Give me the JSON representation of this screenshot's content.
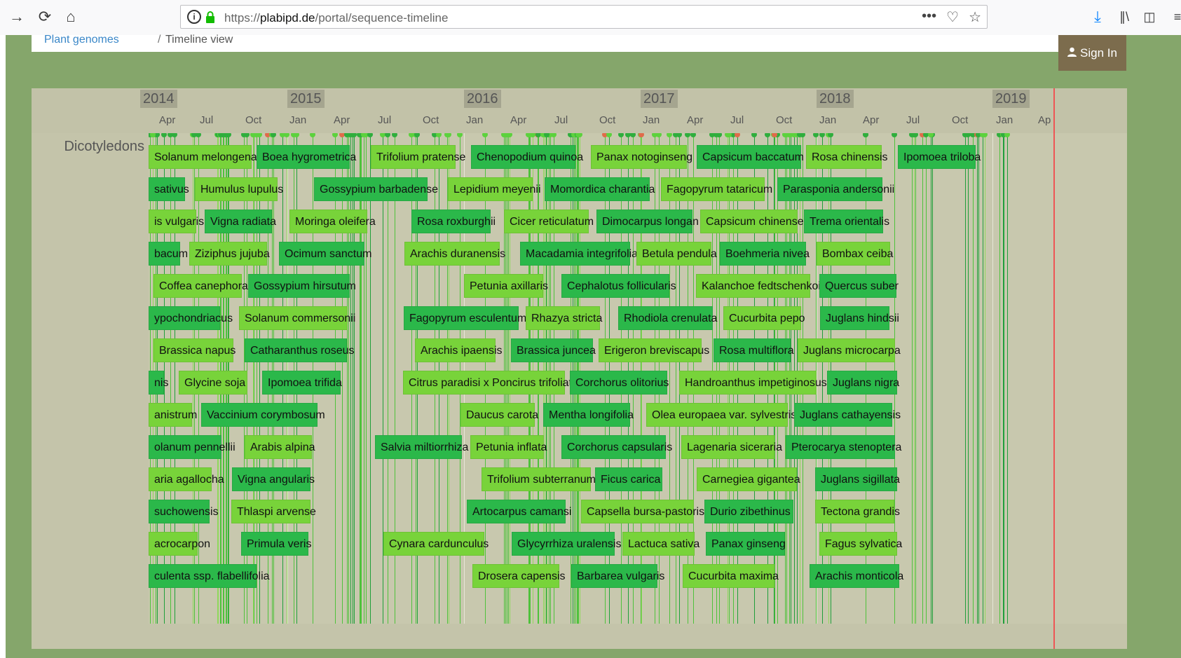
{
  "browser": {
    "url_prefix": "https://",
    "url_domain": "plabipd.de",
    "url_path": "/portal/sequence-timeline"
  },
  "breadcrumb": {
    "home": "Plant genomes",
    "separator": "/",
    "current": "Timeline view"
  },
  "signin_label": "Sign In",
  "group_label": "Dicotyledons",
  "years": [
    "2014",
    "2015",
    "2016",
    "2017",
    "2018",
    "2019"
  ],
  "months": [
    "Apr",
    "Jul",
    "Oct",
    "Jan",
    "Apr",
    "Jul",
    "Oct",
    "Jan",
    "Apr",
    "Jul",
    "Oct",
    "Jan",
    "Apr",
    "Jul",
    "Oct",
    "Jan",
    "Apr",
    "Jul",
    "Oct",
    "Jan",
    "Ap"
  ],
  "rows": [
    [
      "Solanum melongena",
      "Boea hygrometrica",
      "Trifolium pratense",
      "Chenopodium quinoa",
      "Panax notoginseng",
      "Capsicum baccatum",
      "Rosa chinensis",
      "Ipomoea triloba"
    ],
    [
      "sativus",
      "Humulus lupulus",
      "Gossypium barbadense",
      "Lepidium meyenii",
      "Momordica charantia",
      "Fagopyrum tataricum",
      "Parasponia andersonii"
    ],
    [
      "is vulgaris",
      "Vigna radiata",
      "Moringa oleifera",
      "Rosa roxburghii",
      "Cicer reticulatum",
      "Dimocarpus longan",
      "Capsicum chinense",
      "Trema orientalis"
    ],
    [
      "bacum",
      "Ziziphus jujuba",
      "Ocimum sanctum",
      "Arachis duranensis",
      "Macadamia integrifolia",
      "Betula pendula",
      "Boehmeria nivea",
      "Bombax ceiba"
    ],
    [
      "Coffea canephora",
      "Gossypium hirsutum",
      "Petunia axillaris",
      "Cephalotus follicularis",
      "Kalanchoe fedtschenkoi",
      "Quercus suber"
    ],
    [
      "ypochondriacus",
      "Solanum commersonii",
      "Fagopyrum esculentum",
      "Rhazya stricta",
      "Rhodiola crenulata",
      "Cucurbita pepo",
      "Juglans hindsii"
    ],
    [
      "Brassica napus",
      "Catharanthus roseus",
      "Arachis ipaensis",
      "Brassica juncea",
      "Erigeron breviscapus",
      "Rosa multiflora",
      "Juglans microcarpa"
    ],
    [
      "nis",
      "Glycine soja",
      "Ipomoea trifida",
      "Citrus paradisi x Poncirus trifoliata",
      "Corchorus olitorius",
      "Handroanthus impetiginosus",
      "Juglans nigra"
    ],
    [
      "anistrum",
      "Vaccinium corymbosum",
      "Daucus carota",
      "Mentha longifolia",
      "Olea europaea var. sylvestris",
      "Juglans cathayensis"
    ],
    [
      "olanum pennellii",
      "Arabis alpina",
      "Salvia miltiorrhiza",
      "Petunia inflata",
      "Corchorus capsularis",
      "Lagenaria siceraria",
      "Pterocarya stenoptera"
    ],
    [
      "aria agallocha",
      "Vigna angularis",
      "Trifolium subterranum",
      "Ficus carica",
      "Carnegiea gigantea",
      "Juglans sigillata"
    ],
    [
      "suchowensis",
      "Thlaspi arvense",
      "Artocarpus camansi",
      "Capsella bursa-pastoris",
      "Durio zibethinus",
      "Tectona grandis"
    ],
    [
      "acrocarpon",
      "Primula veris",
      "Cynara cardunculus",
      "Glycyrrhiza uralensis",
      "Lactuca sativa",
      "Panax ginseng",
      "Fagus sylvatica"
    ],
    [
      "culenta ssp. flabellifolia",
      "Drosera capensis",
      "Barbarea vulgaris",
      "Cucurbita maxima",
      "Arachis monticola"
    ]
  ],
  "colors": {
    "light": "#78d33a",
    "dark": "#2bb84a",
    "accent": "#3fc85f",
    "today": "#e55555"
  }
}
